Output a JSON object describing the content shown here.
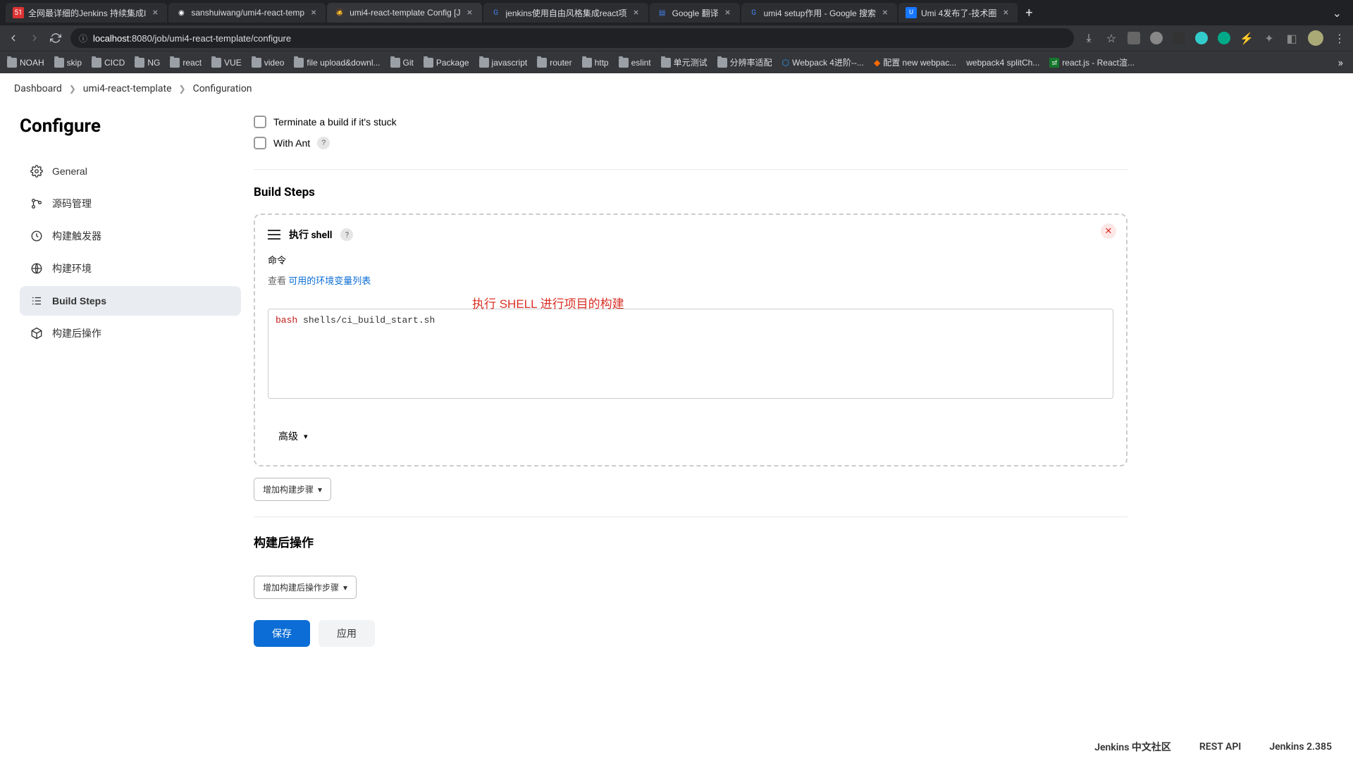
{
  "tabs": [
    {
      "title": "全网最详细的Jenkins 持续集成I",
      "favicon": "51"
    },
    {
      "title": "sanshuiwang/umi4-react-temp",
      "favicon": "gh"
    },
    {
      "title": "umi4-react-template Config [J",
      "favicon": "jw",
      "active": true
    },
    {
      "title": "jenkins使用自由风格集成react项",
      "favicon": "g"
    },
    {
      "title": "Google 翻译",
      "favicon": "gd"
    },
    {
      "title": "umi4 setup作用 - Google 搜索",
      "favicon": "g"
    },
    {
      "title": "Umi 4发布了-技术圈",
      "favicon": "u"
    }
  ],
  "url_host": "localhost",
  "url_port_path": ":8080/job/umi4-react-template/configure",
  "bookmarks": [
    "NOAH",
    "skip",
    "CICD",
    "NG",
    "react",
    "VUE",
    "video",
    "file upload&downl...",
    "Git",
    "Package",
    "javascript",
    "router",
    "http",
    "eslint",
    "单元测试",
    "分辨率适配",
    "Webpack 4进阶--...",
    "配置 new webpac...",
    "webpack4 splitCh...",
    "react.js - React渲..."
  ],
  "breadcrumbs": [
    "Dashboard",
    "umi4-react-template",
    "Configuration"
  ],
  "page_title": "Configure",
  "sidebar": {
    "items": [
      {
        "label": "General"
      },
      {
        "label": "源码管理"
      },
      {
        "label": "构建触发器"
      },
      {
        "label": "构建环境"
      },
      {
        "label": "Build Steps",
        "active": true
      },
      {
        "label": "构建后操作"
      }
    ]
  },
  "checks": {
    "terminate": "Terminate a build if it's stuck",
    "with_ant": "With Ant"
  },
  "sections": {
    "build_steps": "Build Steps",
    "post_build": "构建后操作"
  },
  "step": {
    "title": "执行 shell",
    "field_label": "命令",
    "hint_prefix": "查看 ",
    "hint_link": "可用的环境变量列表",
    "annotation": "执行 SHELL 进行项目的构建",
    "code_kw": "bash",
    "code_rest": " shells/ci_build_start.sh",
    "advanced": "高级"
  },
  "buttons": {
    "add_step": "增加构建步骤",
    "add_post": "增加构建后操作步骤",
    "save": "保存",
    "apply": "应用"
  },
  "footer": {
    "community": "Jenkins 中文社区",
    "rest": "REST API",
    "version": "Jenkins 2.385"
  }
}
